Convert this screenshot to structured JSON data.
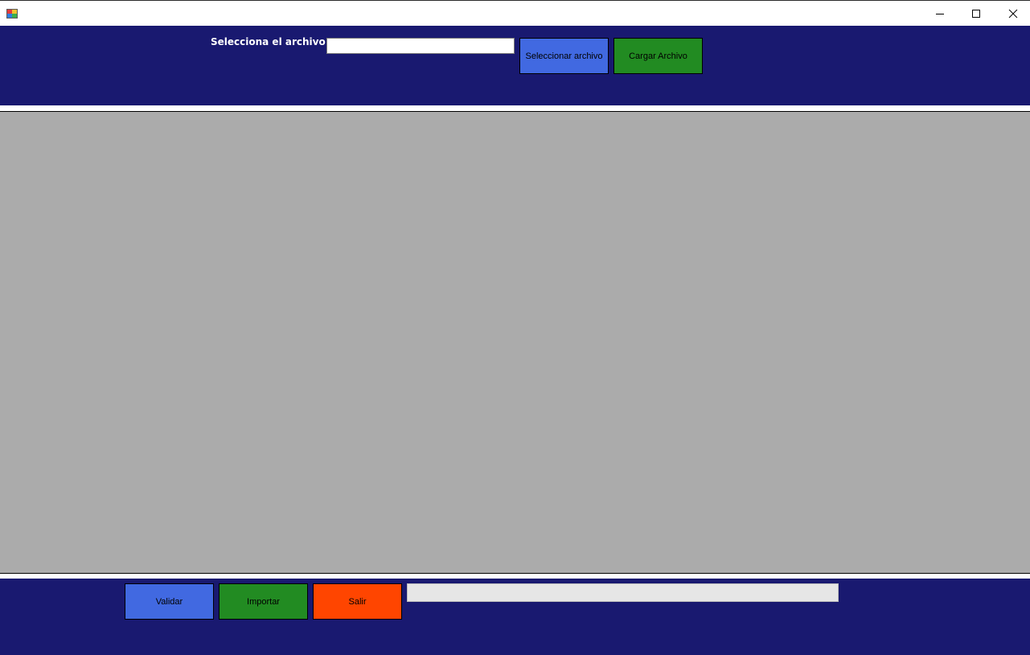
{
  "window": {
    "title": "",
    "icon": "app-form-icon",
    "controls": [
      "minimize-icon",
      "maximize-icon",
      "close-icon"
    ]
  },
  "top_panel": {
    "file_label": "Selecciona el archivo:",
    "file_input": {
      "value": "",
      "placeholder": ""
    },
    "select_button_label": "Seleccionar archivo",
    "load_button_label": "Cargar Archivo"
  },
  "bottom_panel": {
    "validate_button_label": "Validar",
    "import_button_label": "Importar",
    "exit_button_label": "Salir",
    "progress": 0
  },
  "colors": {
    "panel_background": "#191970",
    "grid_background": "#ababab",
    "blue_button": "#4169e1",
    "green_button": "#228b22",
    "orange_button": "#ff4500",
    "progress_track": "#e6e6e6"
  }
}
